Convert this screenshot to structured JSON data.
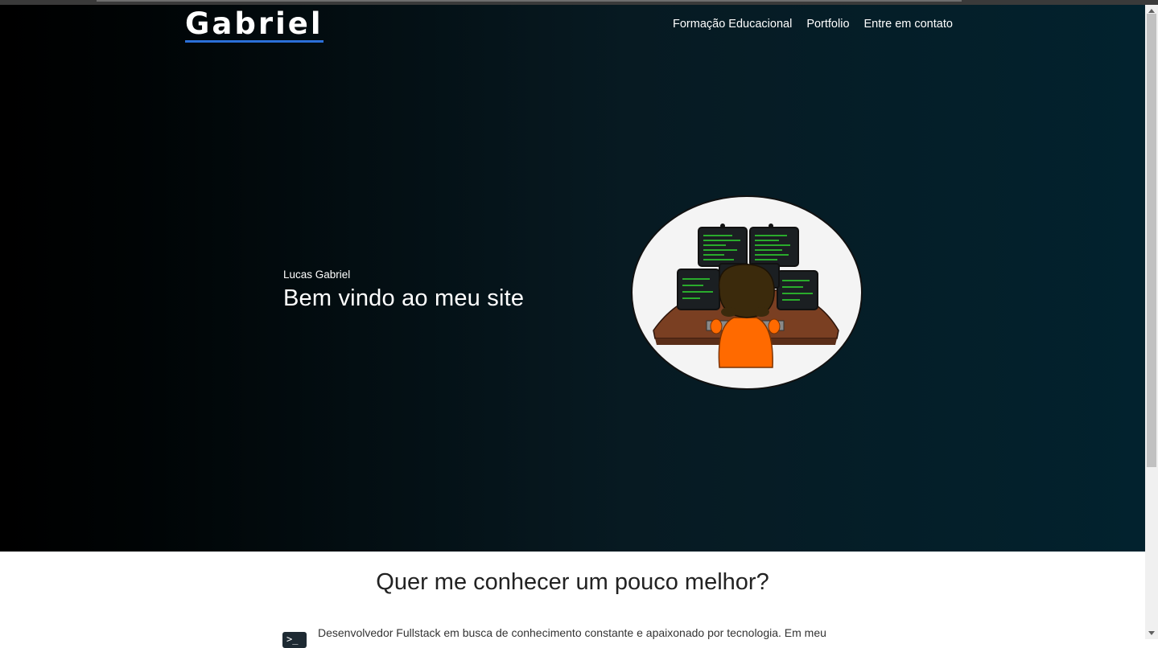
{
  "header": {
    "brand": "Gabriel",
    "nav": [
      "Formação Educacional",
      "Portfolio",
      "Entre em contato"
    ]
  },
  "hero": {
    "subtitle": "Lucas Gabriel",
    "title": "Bem vindo ao meu site",
    "image_icon": "developer-at-monitors-illustration"
  },
  "about": {
    "title": "Quer me conhecer um pouco melhor?",
    "icon": "terminal-icon",
    "text": "Desenvolvedor Fullstack em busca de conhecimento constante e apaixonado por tecnologia. Em meu"
  },
  "colors": {
    "hero_start": "#000000",
    "hero_end": "#02222e",
    "brand_underline": "#2b6fd8",
    "shirt": "#ff6a00",
    "code_text": "#33ff33"
  }
}
